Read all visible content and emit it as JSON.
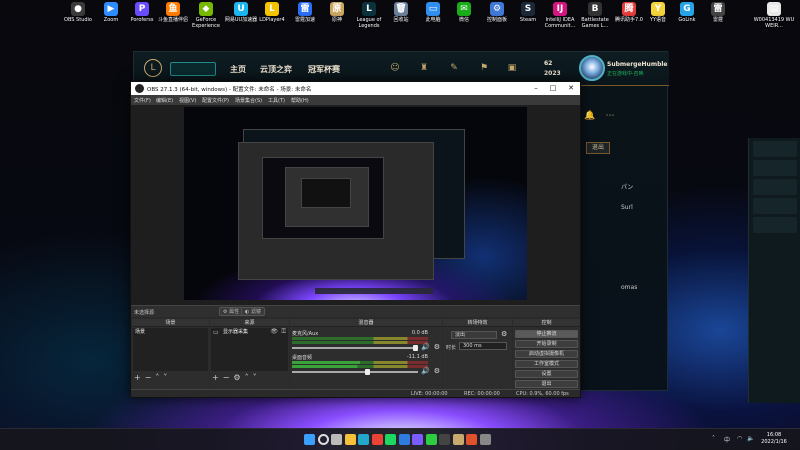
{
  "desktop": {
    "icons": [
      {
        "label": "OBS Studio",
        "color": "#3b3b3b",
        "glyph": "●"
      },
      {
        "label": "Zoom",
        "color": "#2d8cff",
        "glyph": "▶"
      },
      {
        "label": "Poroferss",
        "color": "#6a4cff",
        "glyph": "P"
      },
      {
        "label": "斗鱼直播伴侣",
        "color": "#ff7b00",
        "glyph": "鱼"
      },
      {
        "label": "GeForce Experience",
        "color": "#76b900",
        "glyph": "◆"
      },
      {
        "label": "网易UU加速器",
        "color": "#1bb5f0",
        "glyph": "U"
      },
      {
        "label": "LDPlayer4",
        "color": "#f5c400",
        "glyph": "L"
      },
      {
        "label": "雷霆加速",
        "color": "#2a6ef5",
        "glyph": "雷"
      },
      {
        "label": "原神",
        "color": "#c9a560",
        "glyph": "原"
      },
      {
        "label": "League of Legends",
        "color": "#0a323c",
        "glyph": "L"
      },
      {
        "label": "回收站",
        "color": "#6b7f99",
        "glyph": "🗑"
      },
      {
        "label": "此电脑",
        "color": "#2f8ff0",
        "glyph": "▭"
      },
      {
        "label": "微信",
        "color": "#1aad19",
        "glyph": "✉"
      },
      {
        "label": "控制面板",
        "color": "#3f78d6",
        "glyph": "⚙"
      },
      {
        "label": "Steam",
        "color": "#1b2838",
        "glyph": "S"
      },
      {
        "label": "IntelliJ IDEA Communit...",
        "color": "#d31582",
        "glyph": "IJ"
      },
      {
        "label": "Battlestate Games L...",
        "color": "#333333",
        "glyph": "B"
      },
      {
        "label": "腾讯助手7.0",
        "color": "#e23c3c",
        "glyph": "腾"
      },
      {
        "label": "YY语音",
        "color": "#f4d23a",
        "glyph": "Y"
      },
      {
        "label": "GoLink",
        "color": "#27a3e8",
        "glyph": "G"
      },
      {
        "label": "雷霆",
        "color": "#444444",
        "glyph": "雷"
      },
      {
        "label": "W00413419 WU WEIR...",
        "color": "#e8e8e8",
        "glyph": "▤"
      }
    ]
  },
  "lol_client": {
    "nav": [
      "主页",
      "云顶之弈",
      "冠军杯赛"
    ],
    "stat_be": "62",
    "stat_rp": "2023",
    "username": "SubmergeHumble",
    "status": "正在游戏中·召唤",
    "buttons": {
      "out": "退出"
    },
    "side_text": [
      "パン",
      "Surl",
      "omas"
    ]
  },
  "obs": {
    "title": "OBS 27.1.3 (64-bit, windows) - 配置文件: 未命名 - 场景: 未命名",
    "menu": [
      "文件(F)",
      "编辑(E)",
      "视图(V)",
      "配置文件(P)",
      "场景集合(S)",
      "工具(T)",
      "帮助(H)"
    ],
    "source_bar": {
      "label": "未选择源",
      "props": "属性",
      "filters": "滤镜"
    },
    "docks": {
      "scenes": {
        "title": "场景",
        "items": [
          "场景"
        ]
      },
      "sources": {
        "title": "来源",
        "items": [
          "显示器采集"
        ]
      },
      "mixer": {
        "title": "混音器",
        "channels": [
          {
            "name": "麦克风/Aux",
            "db": "0.0 dB"
          },
          {
            "name": "桌面音频",
            "db": "-11.1 dB"
          }
        ]
      },
      "transitions": {
        "title": "转场特效",
        "type": "淡出",
        "duration_label": "时长",
        "duration": "300 ms"
      },
      "controls": {
        "title": "控制",
        "buttons": [
          "停止推流",
          "开始录制",
          "启动虚拟摄像机",
          "工作室模式",
          "设置",
          "退出"
        ]
      }
    },
    "status": {
      "live": "LIVE: 00:00:00",
      "rec": "REC: 00:00:00",
      "cpu": "CPU: 0.9%, 60.00 fps"
    }
  },
  "taskbar": {
    "icons": [
      {
        "name": "windows-start-icon",
        "color": "#3aa0ff"
      },
      {
        "name": "search-icon",
        "color": "#dddddd"
      },
      {
        "name": "task-view-icon",
        "color": "#bbbbbb"
      },
      {
        "name": "file-explorer-icon",
        "color": "#f5c13d"
      },
      {
        "name": "edge-icon",
        "color": "#22a6c9"
      },
      {
        "name": "chrome-icon",
        "color": "#e84335"
      },
      {
        "name": "spotify-icon",
        "color": "#1ed760"
      },
      {
        "name": "store-icon",
        "color": "#2f7be0"
      },
      {
        "name": "qq-icon",
        "color": "#7b5cff"
      },
      {
        "name": "wechat-icon",
        "color": "#2ecc40"
      },
      {
        "name": "obs-icon",
        "color": "#444444"
      },
      {
        "name": "league-icon",
        "color": "#c8aa6e"
      },
      {
        "name": "game-icon",
        "color": "#e0522b"
      },
      {
        "name": "discord-icon",
        "color": "#888888"
      }
    ],
    "time": "16:08",
    "date": "2022/1/16",
    "lang": "中"
  }
}
